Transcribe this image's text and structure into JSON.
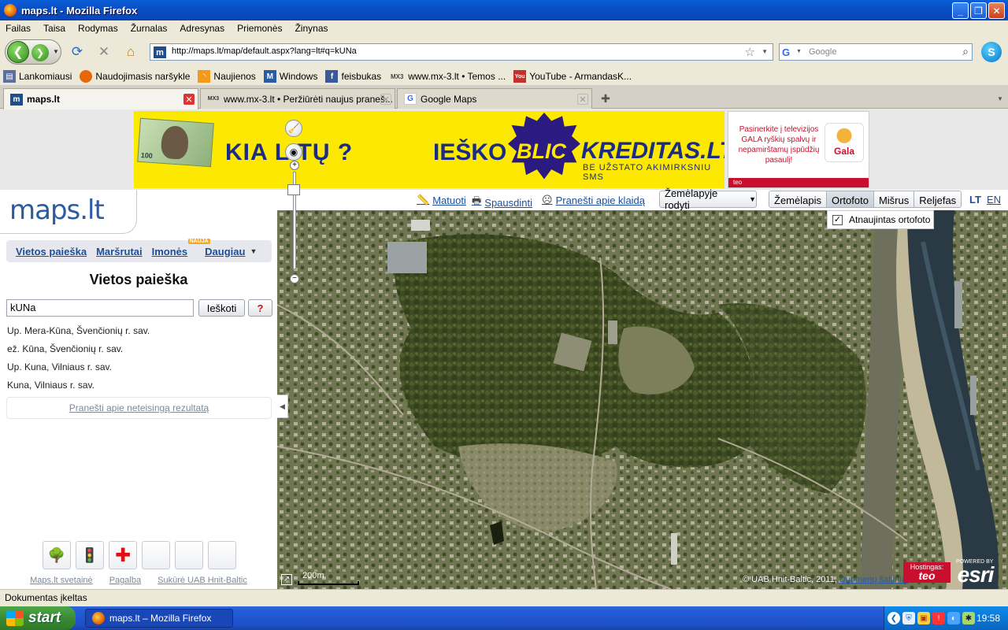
{
  "window": {
    "title": "maps.lt - Mozilla Firefox",
    "minimize": "_",
    "maximize": "❐",
    "close": "✕"
  },
  "menu": [
    "Failas",
    "Taisa",
    "Rodymas",
    "Žurnalas",
    "Adresynas",
    "Priemonės",
    "Žinynas"
  ],
  "toolbar": {
    "url": "http://maps.lt/map/default.aspx?lang=lt#q=kUNa",
    "search_placeholder": "Google"
  },
  "bookmarks": [
    {
      "label": "Lankomiausi",
      "icon": "bookmark-icon",
      "color": "#5a6ea0"
    },
    {
      "label": "Naudojimasis naršykle",
      "icon": "firefox-icon",
      "color": "#e8660a"
    },
    {
      "label": "Naujienos",
      "icon": "rss-icon",
      "color": "#f39a1d"
    },
    {
      "label": "Windows",
      "icon": "windows-icon",
      "color": "#2a5ca3"
    },
    {
      "label": "feisbukas",
      "icon": "facebook-icon",
      "color": "#3b5998"
    },
    {
      "label": "www.mx-3.lt • Temos ...",
      "icon": "mx3-icon",
      "color": "#555555"
    },
    {
      "label": "YouTube - ArmandasK...",
      "icon": "youtube-icon",
      "color": "#c4302b"
    }
  ],
  "tabs": [
    {
      "label": "maps.lt",
      "active": true,
      "favicon": "m"
    },
    {
      "label": "www.mx-3.lt • Peržiūrėti naujus praneš...",
      "active": false,
      "favicon": "MX"
    },
    {
      "label": "Google Maps",
      "active": false,
      "favicon": "G"
    }
  ],
  "ads": {
    "left_kia": "KIA LITŲ ?",
    "note_value": "100",
    "iesko": "IEŠKO",
    "blic": "BLIC",
    "kreditas": "KREDITAS.LT",
    "sub": "BE UŽSTATO  AKIMIRKSNIU  SMS",
    "gala_text": "Pasinerkite į televizijos GALA ryškių spalvų ir nepamirštamų įspūdžių pasaulį!",
    "gala_logo": "Gala",
    "gala_sponsor": "teo"
  },
  "site": {
    "logo": "maps.lt",
    "nav": [
      {
        "label": "Vietos paieška"
      },
      {
        "label": "Maršrutai"
      },
      {
        "label": "Imonės"
      },
      {
        "label": "Daugiau"
      }
    ],
    "naujas_badge": "NAUJA",
    "heading": "Vietos paieška",
    "search_value": "kUNa",
    "search_button": "Ieškoti",
    "help_button": "?",
    "results": [
      "Up. Mera-Kūna, Švenčionių r. sav.",
      "ež. Kūna, Švenčionių r. sav.",
      "Up. Kuna, Vilniaus r. sav.",
      "Kuna, Vilniaus r. sav."
    ],
    "report_link": "Pranešti apie neteisingą rezultatą",
    "footer": [
      "Maps.lt svetainė",
      "Pagalba",
      "Sukūrė UAB Hnit-Baltic"
    ]
  },
  "maptools": {
    "measure": "Matuoti",
    "print": "Spausdinti",
    "report": "Pranešti apie klaidą",
    "show_on_map": "Žemėlapyje rodyti",
    "modes": [
      {
        "label": "Žemėlapis",
        "active": false
      },
      {
        "label": "Ortofoto",
        "active": true
      },
      {
        "label": "Mišrus",
        "active": false
      },
      {
        "label": "Reljefas",
        "active": false
      }
    ],
    "lang_lt": "LT",
    "lang_en": "EN",
    "ortho_checkbox": "Atnaujintas ortofoto",
    "ortho_checked": true
  },
  "map": {
    "scale_label": "200m",
    "copyright": "© UAB Hnit-Baltic, 2011,",
    "copyright_link": "Duomenų šaltiniai",
    "hosting_label": "Hostingas:",
    "hosting_brand": "teo",
    "esri_powered": "POWERED BY",
    "esri_name": "esri"
  },
  "status": "Dokumentas įkeltas",
  "taskbar": {
    "start": "start",
    "window_item": "maps.lt – Mozilla Firefox",
    "clock": "19:58"
  }
}
